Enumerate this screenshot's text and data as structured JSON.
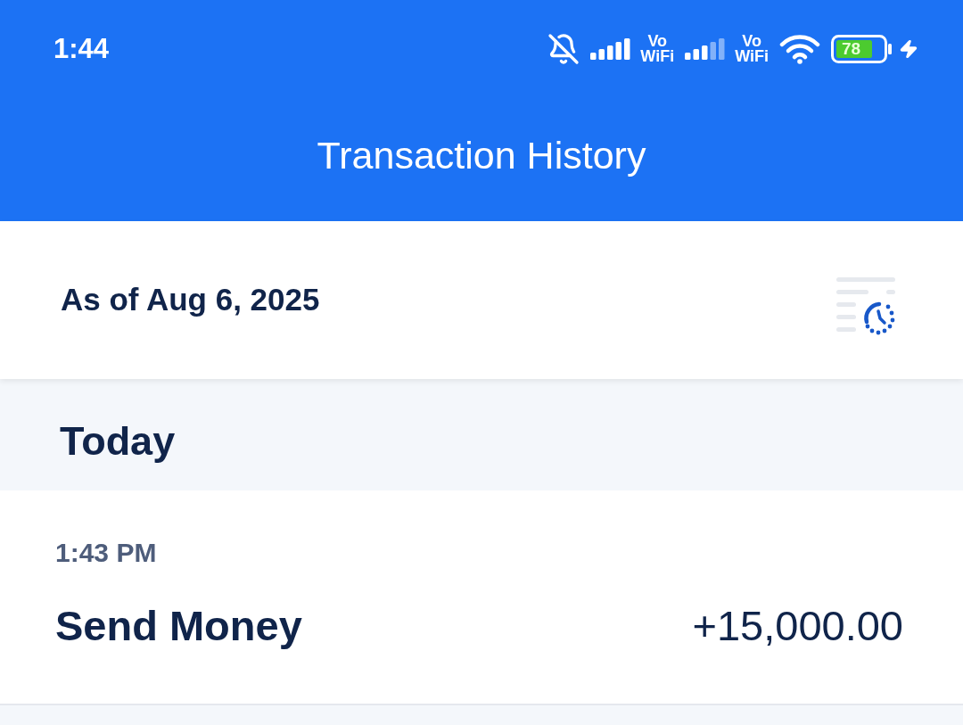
{
  "status_bar": {
    "time": "1:44",
    "sims": [
      {
        "tag_top": "Vo",
        "tag_bottom": "WiFi"
      },
      {
        "tag_top": "Vo",
        "tag_bottom": "WiFi"
      }
    ],
    "battery": "78"
  },
  "header": {
    "title": "Transaction History"
  },
  "summary": {
    "as_of": "As of Aug 6, 2025"
  },
  "groups": [
    {
      "label": "Today",
      "transactions": [
        {
          "time": "1:43 PM",
          "name": "Send Money",
          "amount": "+15,000.00"
        }
      ]
    }
  ]
}
